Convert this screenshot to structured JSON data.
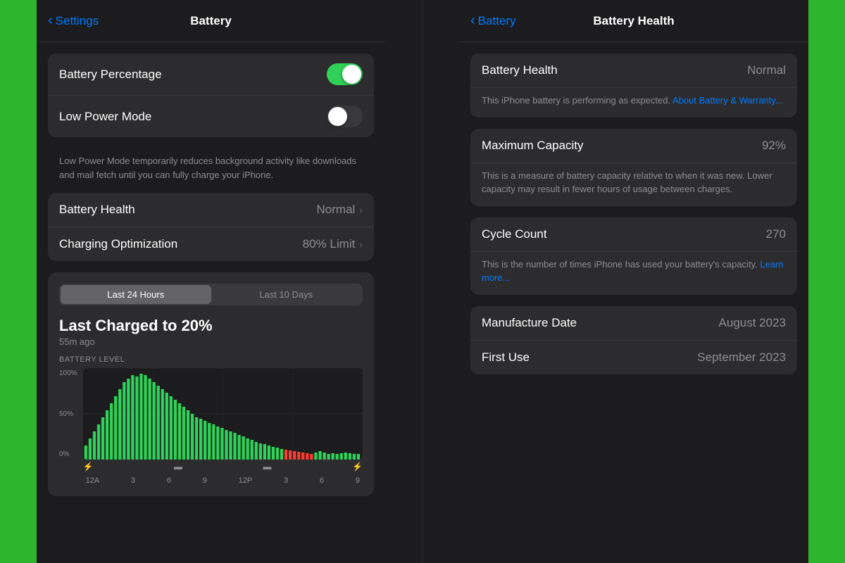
{
  "left": {
    "nav": {
      "back_label": "Settings",
      "title": "Battery"
    },
    "toggles": {
      "battery_percentage": {
        "label": "Battery Percentage",
        "state": "on"
      },
      "low_power_mode": {
        "label": "Low Power Mode",
        "state": "off"
      }
    },
    "note": "Low Power Mode temporarily reduces background activity like downloads and mail fetch until you can fully charge your iPhone.",
    "battery_health": {
      "label": "Battery Health",
      "value": "Normal"
    },
    "charging_optimization": {
      "label": "Charging Optimization",
      "value": "80% Limit"
    },
    "chart": {
      "tabs": [
        "Last 24 Hours",
        "Last 10 Days"
      ],
      "active_tab": 0,
      "charge_title": "Last Charged to 20%",
      "charge_subtitle": "55m ago",
      "chart_label": "BATTERY LEVEL",
      "y_labels": [
        "100%",
        "50%",
        "0%"
      ],
      "x_labels": [
        "12A",
        "3",
        "6",
        "9",
        "12P",
        "3",
        "6",
        "9"
      ],
      "charging_icons": [
        "⚡",
        "■",
        "■",
        "⚡"
      ]
    }
  },
  "right": {
    "nav": {
      "back_label": "Battery",
      "title": "Battery Health"
    },
    "battery_health": {
      "label": "Battery Health",
      "value": "Normal",
      "note_main": "This iPhone battery is performing as expected. ",
      "note_link": "About Battery & Warranty..."
    },
    "maximum_capacity": {
      "label": "Maximum Capacity",
      "value": "92%",
      "note": "This is a measure of battery capacity relative to when it was new. Lower capacity may result in fewer hours of usage between charges."
    },
    "cycle_count": {
      "label": "Cycle Count",
      "value": "270",
      "note_main": "This is the number of times iPhone has used your battery's capacity. ",
      "note_link": "Learn more..."
    },
    "manufacture_date": {
      "label": "Manufacture Date",
      "value": "August 2023"
    },
    "first_use": {
      "label": "First Use",
      "value": "September 2023"
    }
  }
}
